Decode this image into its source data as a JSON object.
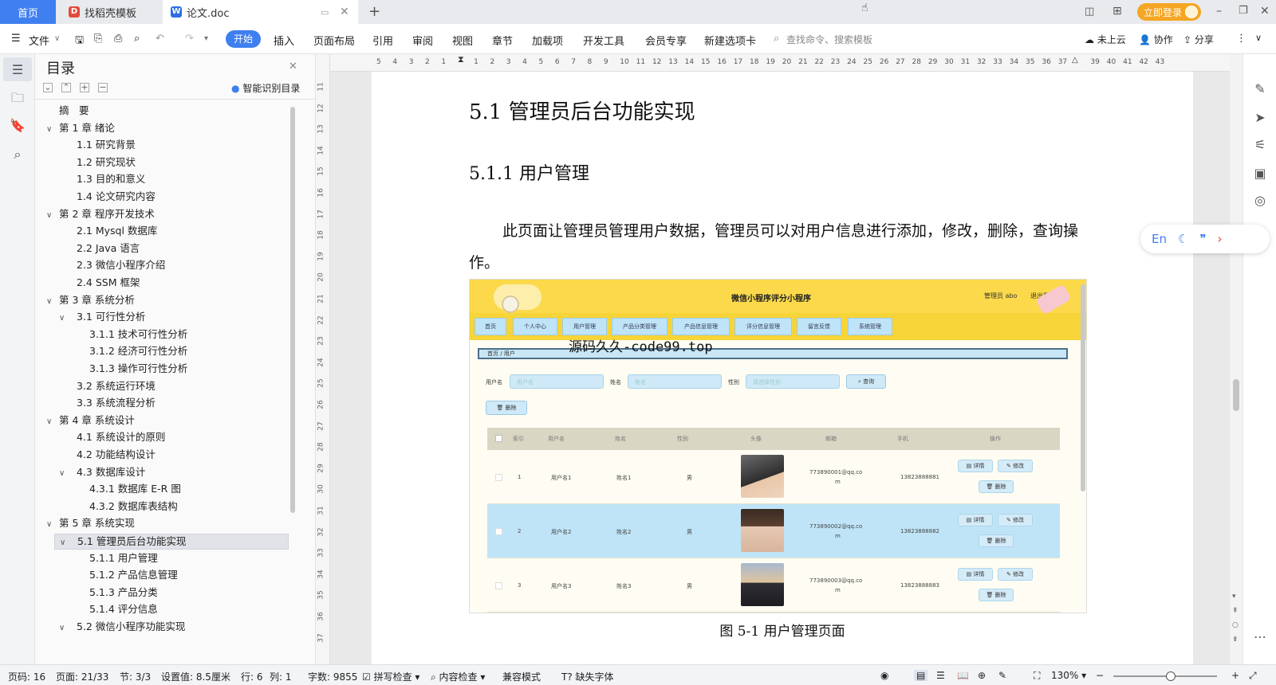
{
  "tabs": {
    "home": "首页",
    "template": "找稻壳模板",
    "doc": "论文.doc",
    "login": "立即登录"
  },
  "menu": {
    "file": "文件",
    "items": [
      "开始",
      "插入",
      "页面布局",
      "引用",
      "审阅",
      "视图",
      "章节",
      "加载项",
      "开发工具",
      "会员专享",
      "新建选项卡"
    ],
    "search_placeholder": "查找命令、搜索模板",
    "cloud": "未上云",
    "collab": "协作",
    "share": "分享"
  },
  "toc": {
    "title": "目录",
    "smart": "智能识别目录",
    "items": [
      {
        "label": "摘　要",
        "level": 0,
        "chev": ""
      },
      {
        "label": "第 1 章  绪论",
        "level": 0,
        "chev": "v"
      },
      {
        "label": "1.1  研究背景",
        "level": 1,
        "chev": ""
      },
      {
        "label": "1.2  研究现状",
        "level": 1,
        "chev": ""
      },
      {
        "label": "1.3  目的和意义",
        "level": 1,
        "chev": ""
      },
      {
        "label": "1.4  论文研究内容",
        "level": 1,
        "chev": ""
      },
      {
        "label": "第 2 章  程序开发技术",
        "level": 0,
        "chev": "v"
      },
      {
        "label": "2.1 Mysql 数据库",
        "level": 1,
        "chev": ""
      },
      {
        "label": "2.2 Java 语言",
        "level": 1,
        "chev": ""
      },
      {
        "label": "2.3  微信小程序介绍",
        "level": 1,
        "chev": ""
      },
      {
        "label": "2.4 SSM 框架",
        "level": 1,
        "chev": ""
      },
      {
        "label": "第 3 章  系统分析",
        "level": 0,
        "chev": "v"
      },
      {
        "label": "3.1 可行性分析",
        "level": 1,
        "chev": "v"
      },
      {
        "label": "3.1.1 技术可行性分析",
        "level": 2,
        "chev": ""
      },
      {
        "label": "3.1.2 经济可行性分析",
        "level": 2,
        "chev": ""
      },
      {
        "label": "3.1.3 操作可行性分析",
        "level": 2,
        "chev": ""
      },
      {
        "label": "3.2 系统运行环境",
        "level": 1,
        "chev": ""
      },
      {
        "label": "3.3 系统流程分析",
        "level": 1,
        "chev": ""
      },
      {
        "label": "第 4 章  系统设计",
        "level": 0,
        "chev": "v"
      },
      {
        "label": "4.1  系统设计的原则",
        "level": 1,
        "chev": ""
      },
      {
        "label": "4.2  功能结构设计",
        "level": 1,
        "chev": ""
      },
      {
        "label": "4.3  数据库设计",
        "level": 1,
        "chev": "v"
      },
      {
        "label": "4.3.1  数据库 E-R 图",
        "level": 2,
        "chev": ""
      },
      {
        "label": "4.3.2  数据库表结构",
        "level": 2,
        "chev": ""
      },
      {
        "label": "第 5 章  系统实现",
        "level": 0,
        "chev": "v"
      },
      {
        "label": "5.1 管理员后台功能实现",
        "level": 1,
        "chev": "v",
        "selected": true
      },
      {
        "label": "5.1.1  用户管理",
        "level": 2,
        "chev": ""
      },
      {
        "label": "5.1.2  产品信息管理",
        "level": 2,
        "chev": ""
      },
      {
        "label": "5.1.3  产品分类",
        "level": 2,
        "chev": ""
      },
      {
        "label": "5.1.4  评分信息",
        "level": 2,
        "chev": ""
      },
      {
        "label": "5.2  微信小程序功能实现",
        "level": 1,
        "chev": "v"
      }
    ]
  },
  "ruler": {
    "h": [
      "5",
      "4",
      "3",
      "2",
      "1",
      "",
      "1",
      "2",
      "3",
      "4",
      "5",
      "6",
      "7",
      "8",
      "9",
      "10",
      "11",
      "12",
      "13",
      "14",
      "15",
      "16",
      "17",
      "18",
      "19",
      "20",
      "21",
      "22",
      "23",
      "24",
      "25",
      "26",
      "27",
      "28",
      "29",
      "30",
      "31",
      "32",
      "33",
      "34",
      "35",
      "36",
      "37",
      "",
      "39",
      "40",
      "41",
      "42",
      "43"
    ],
    "v": [
      "11",
      "12",
      "13",
      "14",
      "15",
      "16",
      "17",
      "18",
      "19",
      "20",
      "21",
      "22",
      "23",
      "24",
      "25",
      "26",
      "27",
      "28",
      "29",
      "30",
      "31",
      "32",
      "33",
      "34",
      "35",
      "36",
      "37"
    ]
  },
  "doc": {
    "h1": "5.1 管理员后台功能实现",
    "h2": "5.1.1  用户管理",
    "para": "此页面让管理员管理用户数据，管理员可以对用户信息进行添加，修改，删除，查询操作。",
    "caption": "图 5-1  用户管理页面"
  },
  "shot": {
    "title": "微信小程序评分小程序",
    "admin": "管理员 abo",
    "logout": "退出登录",
    "nav": [
      "首页",
      "个人中心",
      "用户管理",
      "产品分类管理",
      "产品信息管理",
      "评分信息管理",
      "留言反馈",
      "系统管理"
    ],
    "crumb": "首页  /  用户",
    "watermark": "源码久久-code99.top",
    "filters": {
      "f1": "用户名",
      "f1_ph": "用户名",
      "f2": "姓名",
      "f2_ph": "姓名",
      "f3": "性别",
      "f3_ph": "请选择性别",
      "search": "查询",
      "delete": "删除"
    },
    "headers": [
      "索引",
      "用户名",
      "姓名",
      "性别",
      "头像",
      "邮箱",
      "手机",
      "操作"
    ],
    "rows": [
      {
        "idx": "1",
        "user": "用户名1",
        "name": "姓名1",
        "sex": "男",
        "email": "773890001@qq.co",
        "email2": "m",
        "phone": "13823888881"
      },
      {
        "idx": "2",
        "user": "用户名2",
        "name": "姓名2",
        "sex": "男",
        "email": "773890002@qq.co",
        "email2": "m",
        "phone": "13823888882"
      },
      {
        "idx": "3",
        "user": "用户名3",
        "name": "姓名3",
        "sex": "男",
        "email": "773890003@qq.co",
        "email2": "m",
        "phone": "13823888883"
      }
    ],
    "actions": {
      "detail": "详情",
      "edit": "修改",
      "del": "删除"
    }
  },
  "translate": {
    "lang": "En"
  },
  "status": {
    "pagecode": "页码: 16",
    "page": "页面: 21/33",
    "section": "节: 3/3",
    "setting": "设置值: 8.5厘米",
    "row": "行: 6",
    "col": "列: 1",
    "words": "字数: 9855",
    "spell": "拼写检查",
    "content": "内容检查",
    "compat": "兼容模式",
    "missing_font": "缺失字体",
    "zoom": "130%"
  },
  "colors": {
    "accent": "#3f7ff0",
    "shot_yellow": "#fbd94a",
    "row_highlight": "#bfe4f7"
  }
}
